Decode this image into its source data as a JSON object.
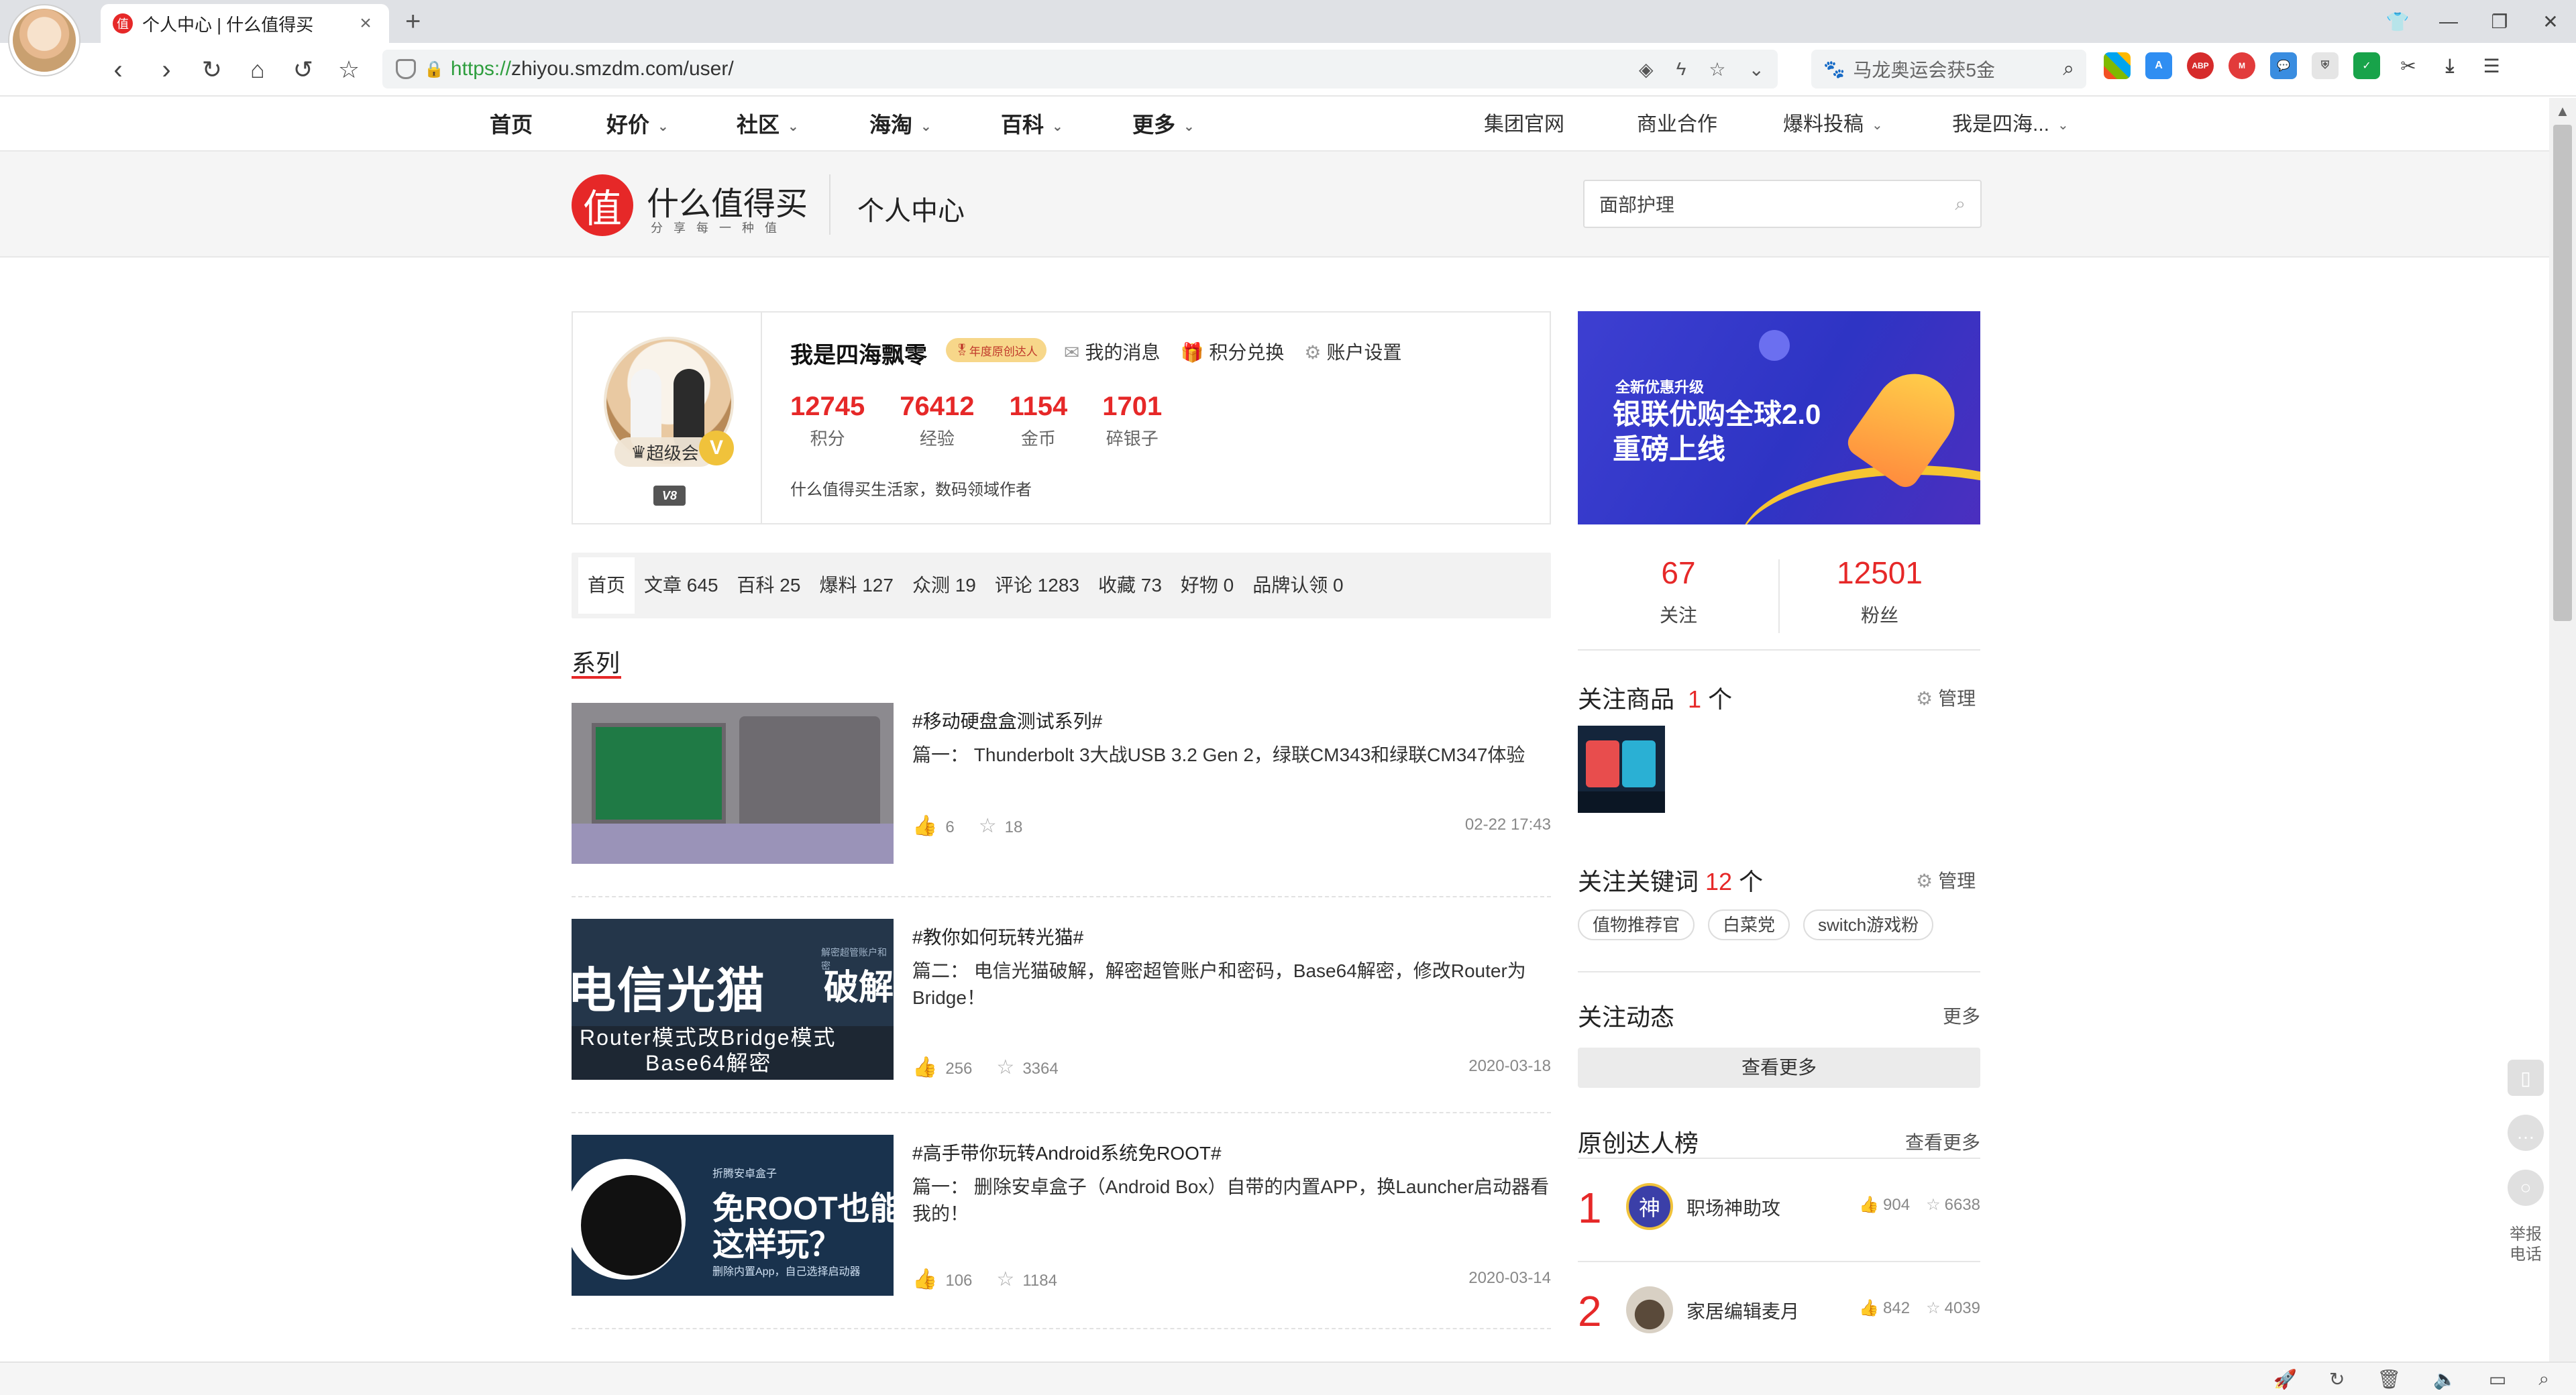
{
  "browser": {
    "tab_title": "个人中心 | 什么值得买",
    "tab_favicon": "值",
    "url_scheme": "https://",
    "url_rest": "zhiyou.smzdm.com/user/",
    "search_text": "马龙奥运会获5金",
    "new_tab": "+",
    "close": "×"
  },
  "sitenav": {
    "items": [
      "首页",
      "好价",
      "社区",
      "海淘",
      "百科",
      "更多"
    ],
    "right_items": [
      "集团官网",
      "商业合作",
      "爆料投稿",
      "我是四海..."
    ]
  },
  "header": {
    "logo_char": "值",
    "logo_title": "什么值得买",
    "logo_slogan": "分享每一种值",
    "page_title": "个人中心",
    "search_value": "面部护理"
  },
  "profile": {
    "username": "我是四海飘零",
    "year_badge": "年度原创达人",
    "links": [
      "我的消息",
      "积分兑换",
      "账户设置"
    ],
    "stats": [
      {
        "value": "12745",
        "label": "积分"
      },
      {
        "value": "76412",
        "label": "经验"
      },
      {
        "value": "1154",
        "label": "金币"
      },
      {
        "value": "1701",
        "label": "碎银子"
      }
    ],
    "bio": "什么值得买生活家，数码领域作者",
    "super_badge": "超级会",
    "level": "V8"
  },
  "ad": {
    "small": "全新优惠升级",
    "line1": "银联优购全球2.0",
    "line2": "重磅上线"
  },
  "tabs": [
    "首页",
    "文章 645",
    "百科 25",
    "爆料 127",
    "众测 19",
    "评论 1283",
    "收藏 73",
    "好物 0",
    "品牌认领 0"
  ],
  "series": {
    "title": "系列",
    "articles": [
      {
        "tag": "#移动硬盘盒测试系列#",
        "desc": "篇一： Thunderbolt 3大战USB 3.2 Gen 2，绿联CM343和绿联CM347体验",
        "likes": "6",
        "favs": "18",
        "date": "02-22 17:43"
      },
      {
        "tag": "#教你如何玩转光猫#",
        "desc": "篇二： 电信光猫破解，解密超管账户和密码，Base64解密，修改Router为Bridge！",
        "likes": "256",
        "favs": "3364",
        "date": "2020-03-18",
        "thumb": {
          "big": "电信光猫",
          "pj": "破解",
          "sub1": "Router模式改Bridge模式",
          "sub2": "Base64解密",
          "tiny": "解密超管账户和密"
        }
      },
      {
        "tag": "#高手带你玩转Android系统免ROOT#",
        "desc": "篇一： 删除安卓盒子（Android Box）自带的内置APP，换Launcher启动器看我的！",
        "likes": "106",
        "favs": "1184",
        "date": "2020-03-14",
        "thumb": {
          "s": "折腾安卓盒子",
          "h1": "免ROOT也能",
          "h2": "这样玩？",
          "s2": "删除内置App，自己选择启动器"
        }
      }
    ]
  },
  "right": {
    "follow": {
      "value": "67",
      "label": "关注"
    },
    "fans": {
      "value": "12501",
      "label": "粉丝"
    },
    "fav_goods": {
      "title": "关注商品",
      "count": "1",
      "unit": "个",
      "manage": "管理"
    },
    "fav_keywords": {
      "title": "关注关键词",
      "count": "12",
      "unit": "个",
      "manage": "管理",
      "items": [
        "值物推荐官",
        "白菜党",
        "switch游戏粉"
      ]
    },
    "dynamics": {
      "title": "关注动态",
      "more": "更多",
      "button": "查看更多"
    },
    "ranking": {
      "title": "原创达人榜",
      "more": "查看更多",
      "rows": [
        {
          "rank": "1",
          "name": "职场神助攻",
          "likes": "904",
          "favs": "6638",
          "avatar_char": "神"
        },
        {
          "rank": "2",
          "name": "家居编辑麦月",
          "likes": "842",
          "favs": "4039",
          "avatar_char": ""
        }
      ]
    }
  },
  "float_bar": {
    "report": "举报\n电话",
    "report_line1": "举报",
    "report_line2": "电话"
  },
  "colors": {
    "brand_red": "#e62828",
    "ad_blue": "#3d3fd1"
  }
}
